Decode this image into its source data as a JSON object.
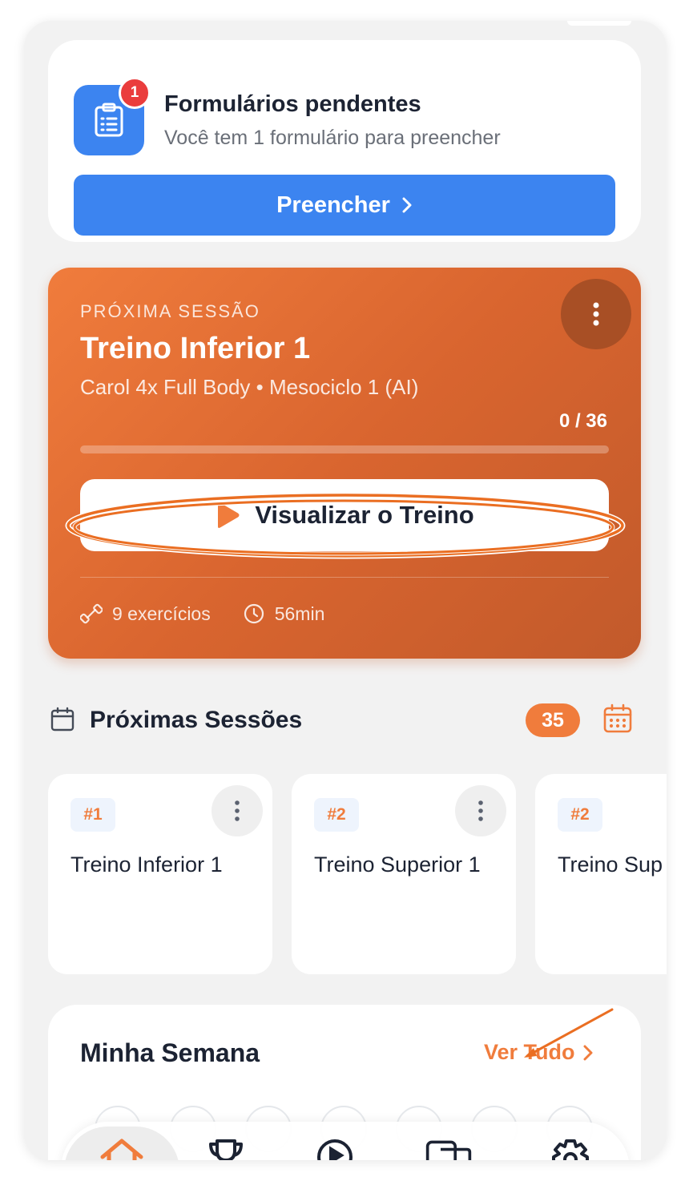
{
  "forms": {
    "badge_count": "1",
    "title": "Formulários pendentes",
    "subtitle": "Você tem 1 formulário para preencher",
    "button_label": "Preencher",
    "icon": "clipboard-icon"
  },
  "next_session": {
    "kicker": "PRÓXIMA SESSÃO",
    "title": "Treino Inferior 1",
    "subtitle": "Carol 4x Full Body • Mesociclo 1 (AI)",
    "progress_text": "0 / 36",
    "progress_fraction": 0,
    "view_button_label": "Visualizar o Treino",
    "exercises": "9 exercícios",
    "duration": "56min",
    "colors": {
      "gradient_start": "#f07c3c",
      "gradient_end": "#c25a2b"
    }
  },
  "upcoming": {
    "title": "Próximas Sessões",
    "count": "35",
    "tiles": [
      {
        "num": "#1",
        "name": "Treino Inferior 1"
      },
      {
        "num": "#2",
        "name": "Treino Superior 1"
      },
      {
        "num": "#2",
        "name": "Treino Sup"
      }
    ]
  },
  "week": {
    "title": "Minha Semana",
    "see_all": "Ver Tudo"
  },
  "nav": {
    "items": [
      "home-icon",
      "trophy-icon",
      "play-icon",
      "chat-icon",
      "gear-icon"
    ],
    "active": "home-icon"
  },
  "colors": {
    "accent": "#f07c3c",
    "primary_blue": "#3c84f0",
    "badge_red": "#ea3d3d"
  }
}
